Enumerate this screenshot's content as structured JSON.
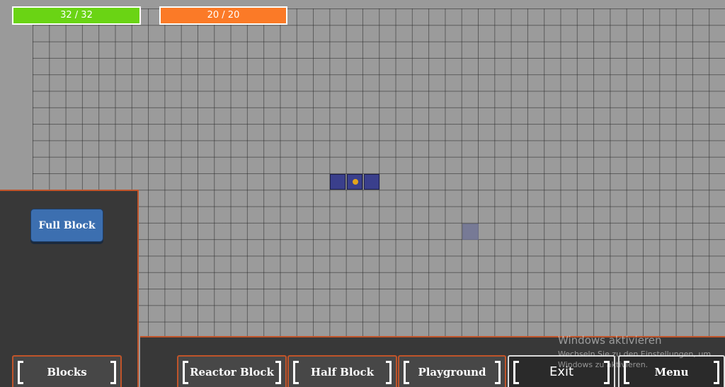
{
  "hud": {
    "health": {
      "label": "32 / 32",
      "value": 32,
      "max": 32,
      "color": "#6ad414"
    },
    "energy": {
      "label": "20 / 20",
      "value": 20,
      "max": 20,
      "color": "#fb7a27"
    }
  },
  "block_panel": {
    "selected_block_label": "Full Block"
  },
  "tabs": {
    "blocks": "Blocks",
    "reactor_block": "Reactor Block",
    "half_block": "Half Block",
    "playground": "Playground",
    "exit": "Exit",
    "menu": "Menu"
  },
  "windows_watermark": {
    "title": "Windows aktivieren",
    "subtitle": "Wechseln Sie zu den Einstellungen, um Windows zu aktivieren."
  },
  "colors": {
    "accent_border": "#c0542a",
    "block_fill": "#3a3f8c",
    "core_dot": "#e3a51a",
    "panel_bg": "#383838"
  }
}
